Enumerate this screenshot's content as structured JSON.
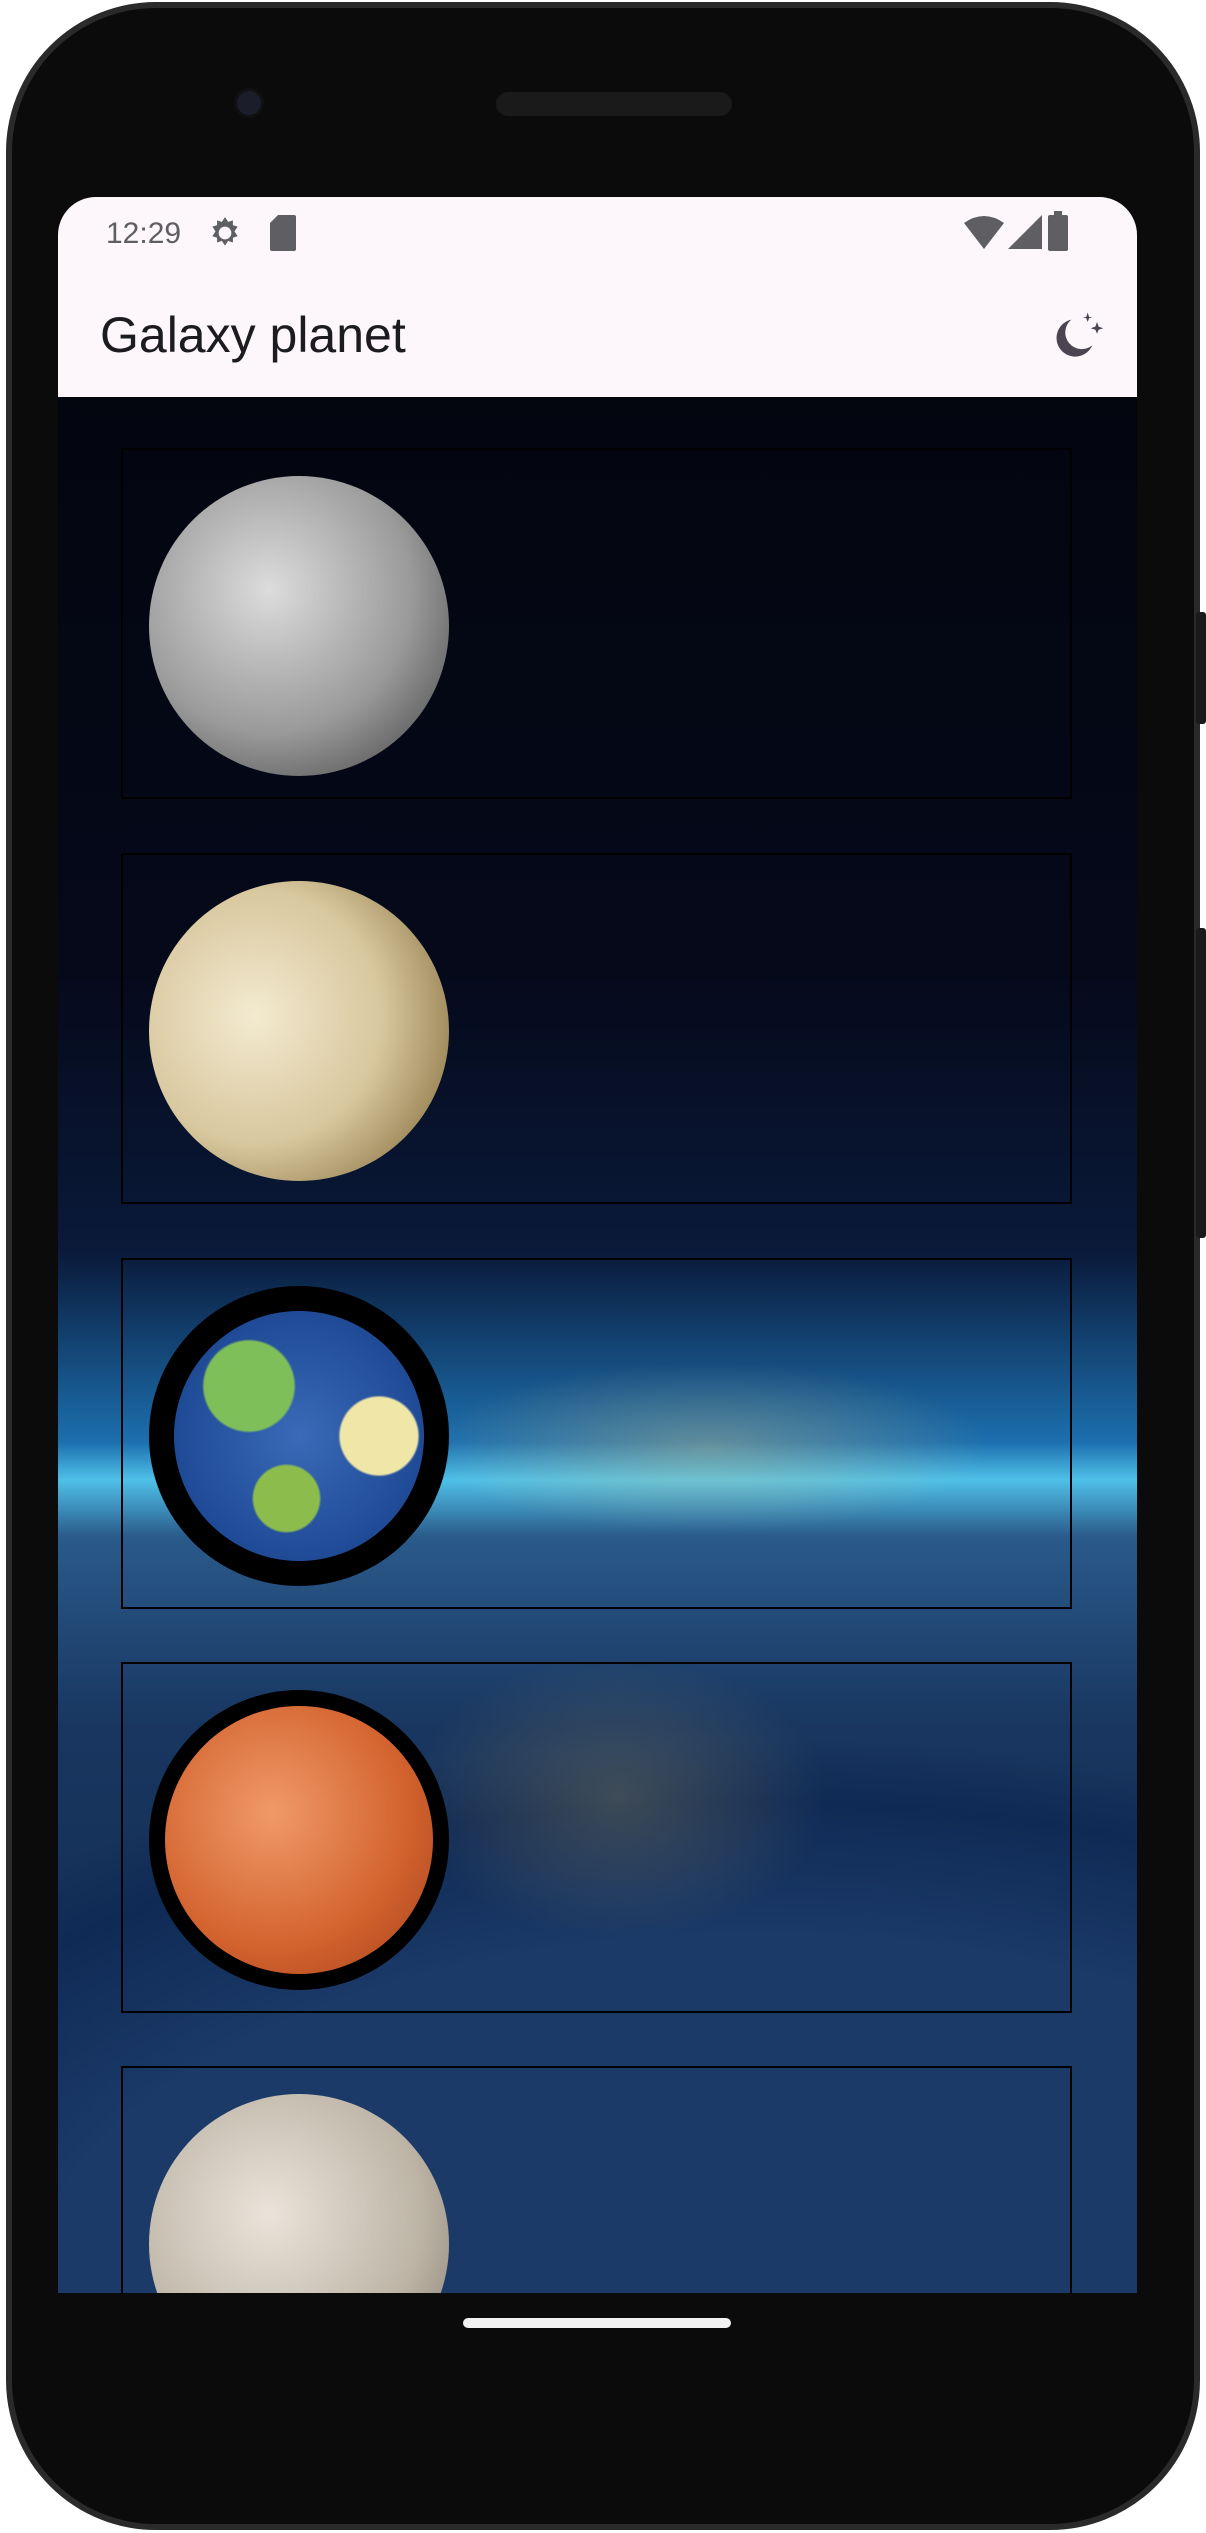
{
  "status_bar": {
    "time": "12:29",
    "icons": [
      "settings-gear-icon",
      "sd-card-icon",
      "wifi-icon",
      "cellular-signal-icon",
      "battery-icon"
    ]
  },
  "app_bar": {
    "title": "Galaxy planet",
    "action_icon": "dark-mode-moon-stars-icon"
  },
  "planets": [
    {
      "name": "mercury",
      "colors": [
        "#d6d6d6",
        "#8a8a8a",
        "#3a3a3a"
      ]
    },
    {
      "name": "venus",
      "colors": [
        "#efe4c4",
        "#c9b68a",
        "#4a3d24"
      ]
    },
    {
      "name": "earth",
      "colors": [
        "#6fb3e8",
        "#2a5aa0",
        "#123266"
      ]
    },
    {
      "name": "mars",
      "colors": [
        "#f3a070",
        "#d0602e",
        "#8a3414"
      ]
    },
    {
      "name": "moon",
      "colors": [
        "#e6e0d6",
        "#b3aa9c",
        "#6a6258"
      ]
    }
  ]
}
